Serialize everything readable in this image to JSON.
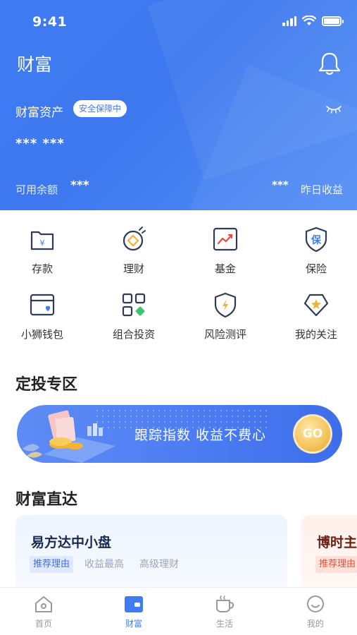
{
  "status_bar": {
    "time": "9:41"
  },
  "header": {
    "title": "财富",
    "assets_label": "财富资产",
    "safe_badge": "安全保障中",
    "asset_value": "*** ***",
    "available_label": "可用余额",
    "available_value": "***",
    "yesterday_value": "***",
    "yesterday_label": "昨日收益",
    "colors": {
      "primary": "#3f7bf2"
    }
  },
  "menu": [
    {
      "label": "存款",
      "icon": "deposit-folder-icon"
    },
    {
      "label": "理财",
      "icon": "wealth-coin-icon"
    },
    {
      "label": "基金",
      "icon": "fund-chart-icon"
    },
    {
      "label": "保险",
      "icon": "insurance-shield-icon"
    },
    {
      "label": "小狮钱包",
      "icon": "wallet-icon"
    },
    {
      "label": "组合投资",
      "icon": "portfolio-grid-icon"
    },
    {
      "label": "风险测评",
      "icon": "risk-shield-icon"
    },
    {
      "label": "我的关注",
      "icon": "favorite-star-icon"
    }
  ],
  "sections": {
    "fixed_invest": "定投专区",
    "wealth_direct": "财富直达"
  },
  "banner": {
    "text": "跟踪指数 收益不费心",
    "go_label": "GO"
  },
  "cards": [
    {
      "title": "易方达中小盘",
      "tag": "推荐理由",
      "reasons": [
        "收益最高",
        "高级理财"
      ]
    },
    {
      "title": "博时主",
      "tag": "推荐理由"
    }
  ],
  "tabbar": [
    {
      "label": "首页",
      "icon": "home-icon",
      "active": false
    },
    {
      "label": "财富",
      "icon": "wallet-icon",
      "active": true
    },
    {
      "label": "生活",
      "icon": "cup-icon",
      "active": false
    },
    {
      "label": "我的",
      "icon": "profile-icon",
      "active": false
    }
  ]
}
